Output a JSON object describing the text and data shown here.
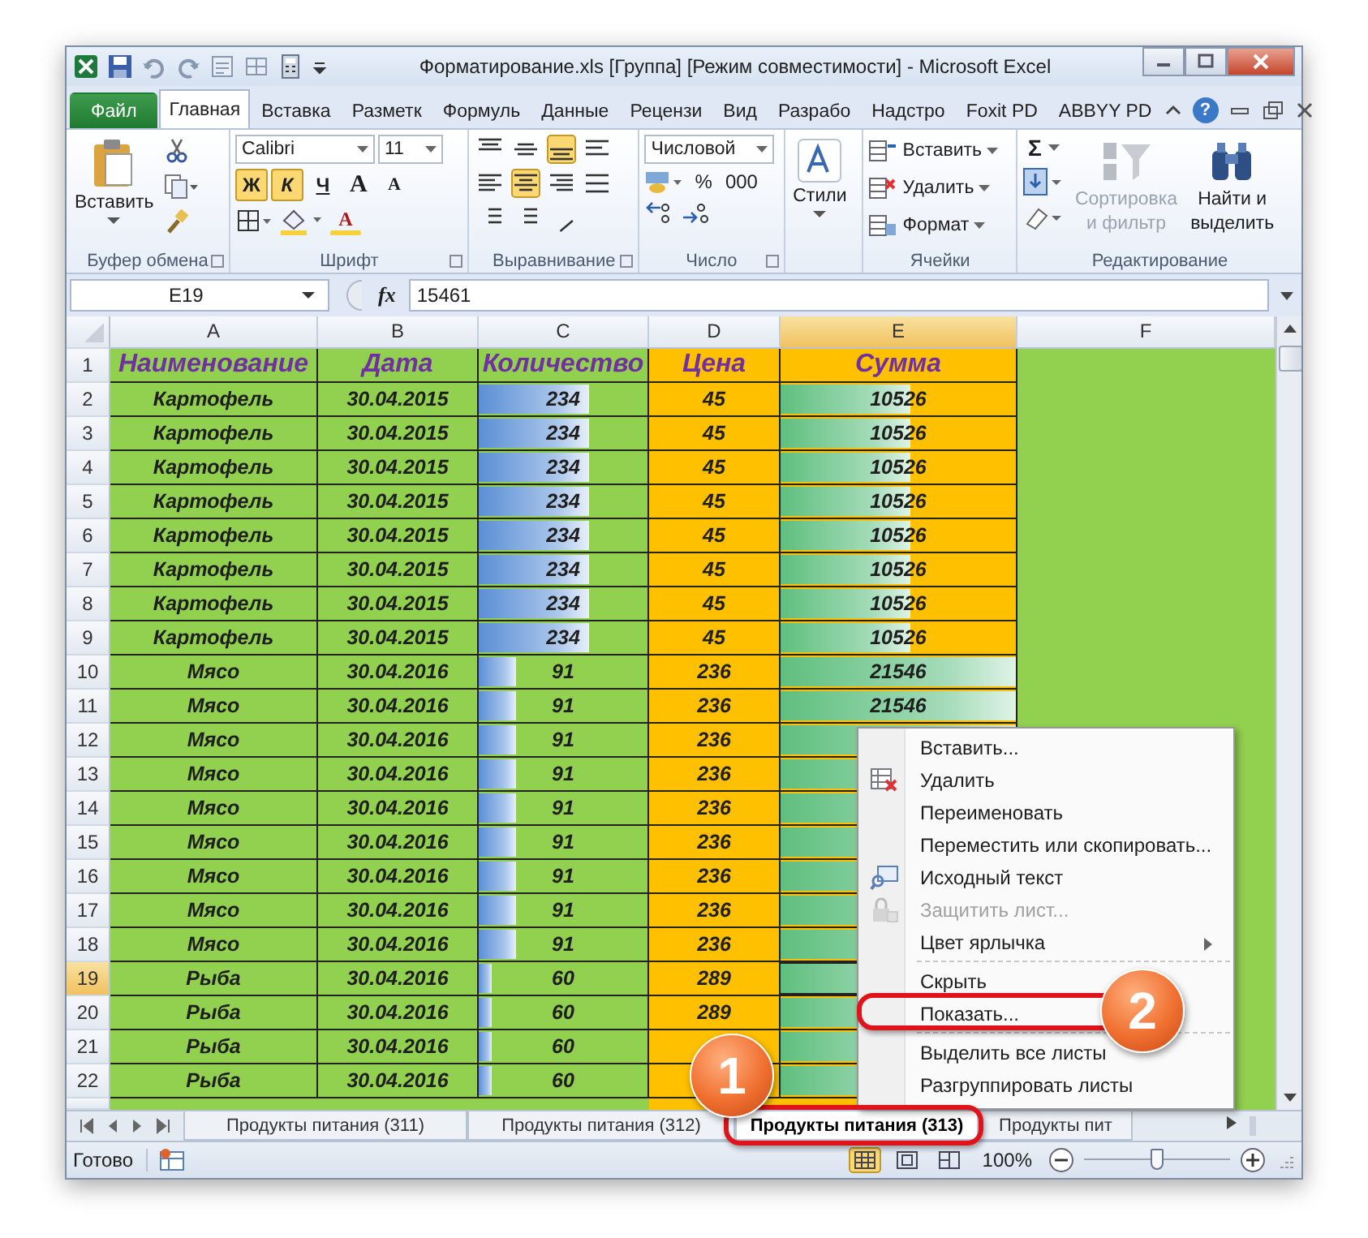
{
  "window": {
    "title": "Форматирование.xls [Группа] [Режим совместимости] - Microsoft Excel"
  },
  "ribbon_tabs": [
    {
      "text": "Файл",
      "kind": "file",
      "selected": false
    },
    {
      "text": "Главная",
      "kind": "tab",
      "selected": true
    },
    {
      "text": "Вставка",
      "kind": "tab",
      "selected": false
    },
    {
      "text": "Разметк",
      "kind": "tab",
      "selected": false
    },
    {
      "text": "Формуль",
      "kind": "tab",
      "selected": false
    },
    {
      "text": "Данные",
      "kind": "tab",
      "selected": false
    },
    {
      "text": "Рецензи",
      "kind": "tab",
      "selected": false
    },
    {
      "text": "Вид",
      "kind": "tab",
      "selected": false
    },
    {
      "text": "Разрабо",
      "kind": "tab",
      "selected": false
    },
    {
      "text": "Надстро",
      "kind": "tab",
      "selected": false
    },
    {
      "text": "Foxit PD",
      "kind": "tab",
      "selected": false
    },
    {
      "text": "ABBYY PD",
      "kind": "tab",
      "selected": false
    }
  ],
  "help": "?",
  "clipboard": {
    "paste": "Вставить",
    "label": "Буфер обмена"
  },
  "font": {
    "family": "Calibri",
    "size": "11",
    "label": "Шрифт",
    "grow": "A",
    "shrink": "A",
    "color_letter": "A",
    "buttons": [
      {
        "text": "Ж",
        "selected": true
      },
      {
        "text": "К",
        "selected": true
      },
      {
        "text": "Ч",
        "selected": false
      }
    ]
  },
  "alignment": {
    "label": "Выравнивание",
    "rows": [
      [
        {
          "kind": "top",
          "selected": false
        },
        {
          "kind": "middle",
          "selected": false
        },
        {
          "kind": "bottom",
          "selected": true
        },
        {
          "kind": "wrap",
          "selected": false
        }
      ],
      [
        {
          "kind": "left",
          "selected": false
        },
        {
          "kind": "center",
          "selected": true
        },
        {
          "kind": "right",
          "selected": false
        },
        {
          "kind": "merge",
          "selected": false
        }
      ],
      [
        {
          "kind": "outdent",
          "selected": false
        },
        {
          "kind": "indent",
          "selected": false
        },
        {
          "kind": "orientation",
          "selected": false
        }
      ]
    ]
  },
  "number": {
    "format": "Числовой",
    "percent": "%",
    "thousands": "000",
    "label": "Число"
  },
  "styles": {
    "button": "Стили"
  },
  "cells_group": {
    "label": "Ячейки",
    "items": [
      {
        "kind": "insert",
        "text": "Вставить"
      },
      {
        "kind": "delete",
        "text": "Удалить"
      },
      {
        "kind": "format",
        "text": "Формат"
      }
    ]
  },
  "editing": {
    "label": "Редактирование",
    "sigma": "Σ",
    "sort": {
      "lines": [
        "Сортировка",
        "и фильтр"
      ],
      "disabled": true
    },
    "find": {
      "lines": [
        "Найти и",
        "выделить"
      ]
    }
  },
  "formula_bar": {
    "name_box": "E19",
    "fx": "fx",
    "value": "15461"
  },
  "columns": [
    {
      "label": "A",
      "selected": false,
      "color": "#92d050"
    },
    {
      "label": "B",
      "selected": false,
      "color": "#92d050"
    },
    {
      "label": "C",
      "selected": false,
      "color": "#92d050"
    },
    {
      "label": "D",
      "selected": false,
      "color": "#ffc000"
    },
    {
      "label": "E",
      "selected": true,
      "color": "#ffc000"
    },
    {
      "label": "F",
      "selected": false,
      "color": "#92d050"
    }
  ],
  "rows": [
    {
      "number": "1",
      "selected": false,
      "kind": "header",
      "cells": [
        {
          "text": "Наименование"
        },
        {
          "text": "Дата"
        },
        {
          "text": "Количество"
        },
        {
          "text": "Цена"
        },
        {
          "text": "Сумма"
        }
      ]
    },
    {
      "number": "2",
      "selected": false,
      "kind": "data",
      "cells": [
        {
          "text": "Картофель"
        },
        {
          "text": "30.04.2015"
        },
        {
          "text": "234",
          "level": 0.65
        },
        {
          "text": "45"
        },
        {
          "text": "10526",
          "level": 0.55
        }
      ]
    },
    {
      "number": "3",
      "selected": false,
      "kind": "data",
      "cells": [
        {
          "text": "Картофель"
        },
        {
          "text": "30.04.2015"
        },
        {
          "text": "234",
          "level": 0.65
        },
        {
          "text": "45"
        },
        {
          "text": "10526",
          "level": 0.55
        }
      ]
    },
    {
      "number": "4",
      "selected": false,
      "kind": "data",
      "cells": [
        {
          "text": "Картофель"
        },
        {
          "text": "30.04.2015"
        },
        {
          "text": "234",
          "level": 0.65
        },
        {
          "text": "45"
        },
        {
          "text": "10526",
          "level": 0.55
        }
      ]
    },
    {
      "number": "5",
      "selected": false,
      "kind": "data",
      "cells": [
        {
          "text": "Картофель"
        },
        {
          "text": "30.04.2015"
        },
        {
          "text": "234",
          "level": 0.65
        },
        {
          "text": "45"
        },
        {
          "text": "10526",
          "level": 0.55
        }
      ]
    },
    {
      "number": "6",
      "selected": false,
      "kind": "data",
      "cells": [
        {
          "text": "Картофель"
        },
        {
          "text": "30.04.2015"
        },
        {
          "text": "234",
          "level": 0.65
        },
        {
          "text": "45"
        },
        {
          "text": "10526",
          "level": 0.55
        }
      ]
    },
    {
      "number": "7",
      "selected": false,
      "kind": "data",
      "cells": [
        {
          "text": "Картофель"
        },
        {
          "text": "30.04.2015"
        },
        {
          "text": "234",
          "level": 0.65
        },
        {
          "text": "45"
        },
        {
          "text": "10526",
          "level": 0.55
        }
      ]
    },
    {
      "number": "8",
      "selected": false,
      "kind": "data",
      "cells": [
        {
          "text": "Картофель"
        },
        {
          "text": "30.04.2015"
        },
        {
          "text": "234",
          "level": 0.65
        },
        {
          "text": "45"
        },
        {
          "text": "10526",
          "level": 0.55
        }
      ]
    },
    {
      "number": "9",
      "selected": false,
      "kind": "data",
      "cells": [
        {
          "text": "Картофель"
        },
        {
          "text": "30.04.2015"
        },
        {
          "text": "234",
          "level": 0.65
        },
        {
          "text": "45"
        },
        {
          "text": "10526",
          "level": 0.55
        }
      ]
    },
    {
      "number": "10",
      "selected": false,
      "kind": "data",
      "cells": [
        {
          "text": "Мясо"
        },
        {
          "text": "30.04.2016"
        },
        {
          "text": "91",
          "level": 0.22
        },
        {
          "text": "236"
        },
        {
          "text": "21546",
          "level": 1
        }
      ]
    },
    {
      "number": "11",
      "selected": false,
      "kind": "data",
      "cells": [
        {
          "text": "Мясо"
        },
        {
          "text": "30.04.2016"
        },
        {
          "text": "91",
          "level": 0.22
        },
        {
          "text": "236"
        },
        {
          "text": "21546",
          "level": 1
        }
      ]
    },
    {
      "number": "12",
      "selected": false,
      "kind": "data",
      "cells": [
        {
          "text": "Мясо"
        },
        {
          "text": "30.04.2016"
        },
        {
          "text": "91",
          "level": 0.22
        },
        {
          "text": "236"
        },
        {
          "level": 1
        }
      ]
    },
    {
      "number": "13",
      "selected": false,
      "kind": "data",
      "cells": [
        {
          "text": "Мясо"
        },
        {
          "text": "30.04.2016"
        },
        {
          "text": "91",
          "level": 0.22
        },
        {
          "text": "236"
        },
        {
          "level": 1
        }
      ]
    },
    {
      "number": "14",
      "selected": false,
      "kind": "data",
      "cells": [
        {
          "text": "Мясо"
        },
        {
          "text": "30.04.2016"
        },
        {
          "text": "91",
          "level": 0.22
        },
        {
          "text": "236"
        },
        {
          "level": 1
        }
      ]
    },
    {
      "number": "15",
      "selected": false,
      "kind": "data",
      "cells": [
        {
          "text": "Мясо"
        },
        {
          "text": "30.04.2016"
        },
        {
          "text": "91",
          "level": 0.22
        },
        {
          "text": "236"
        },
        {
          "level": 1
        }
      ]
    },
    {
      "number": "16",
      "selected": false,
      "kind": "data",
      "cells": [
        {
          "text": "Мясо"
        },
        {
          "text": "30.04.2016"
        },
        {
          "text": "91",
          "level": 0.22
        },
        {
          "text": "236"
        },
        {
          "level": 1
        }
      ]
    },
    {
      "number": "17",
      "selected": false,
      "kind": "data",
      "cells": [
        {
          "text": "Мясо"
        },
        {
          "text": "30.04.2016"
        },
        {
          "text": "91",
          "level": 0.22
        },
        {
          "text": "236"
        },
        {
          "level": 1
        }
      ]
    },
    {
      "number": "18",
      "selected": false,
      "kind": "data",
      "cells": [
        {
          "text": "Мясо"
        },
        {
          "text": "30.04.2016"
        },
        {
          "text": "91",
          "level": 0.22
        },
        {
          "text": "236"
        },
        {
          "level": 1
        }
      ]
    },
    {
      "number": "19",
      "selected": true,
      "kind": "data",
      "cells": [
        {
          "text": "Рыба"
        },
        {
          "text": "30.04.2016"
        },
        {
          "text": "60",
          "level": 0.08
        },
        {
          "text": "289"
        },
        {
          "level": 0.7
        }
      ]
    },
    {
      "number": "20",
      "selected": false,
      "kind": "data",
      "cells": [
        {
          "text": "Рыба"
        },
        {
          "text": "30.04.2016"
        },
        {
          "text": "60",
          "level": 0.08
        },
        {
          "text": "289"
        },
        {
          "level": 0.7
        }
      ]
    },
    {
      "number": "21",
      "selected": false,
      "kind": "data",
      "cells": [
        {
          "text": "Рыба"
        },
        {
          "text": "30.04.2016"
        },
        {
          "text": "60",
          "level": 0.08
        },
        {},
        {
          "level": 0.7
        }
      ]
    },
    {
      "number": "22",
      "selected": false,
      "kind": "data",
      "cells": [
        {
          "text": "Рыба"
        },
        {
          "text": "30.04.2016"
        },
        {
          "text": "60",
          "level": 0.08
        },
        {},
        {
          "level": 0.7
        }
      ]
    }
  ],
  "sheet_tabs": [
    {
      "text": "Продукты питания (311)",
      "selected": false
    },
    {
      "text": "Продукты питания (312)",
      "selected": false
    },
    {
      "text": "Продукты питания (313)",
      "selected": true
    },
    {
      "text": "Продукты пит",
      "selected": false
    }
  ],
  "context_menu": {
    "items": [
      {
        "kind": "plain",
        "text": "Вставить...",
        "disabled": false
      },
      {
        "kind": "delete",
        "text": "Удалить",
        "disabled": false
      },
      {
        "kind": "plain",
        "text": "Переименовать",
        "disabled": false
      },
      {
        "kind": "plain",
        "text": "Переместить или скопировать...",
        "disabled": false
      },
      {
        "kind": "code",
        "text": "Исходный текст",
        "disabled": false
      },
      {
        "kind": "protect",
        "text": "Защитить лист...",
        "disabled": true
      },
      {
        "kind": "submenu",
        "text": "Цвет ярлычка",
        "disabled": false
      },
      {
        "kind": "separator"
      },
      {
        "kind": "plain",
        "text": "Скрыть",
        "disabled": false
      },
      {
        "kind": "plain",
        "text": "Показать...",
        "disabled": false
      },
      {
        "kind": "separator"
      },
      {
        "kind": "plain",
        "text": "Выделить все листы",
        "disabled": false
      },
      {
        "kind": "plain",
        "text": "Разгруппировать листы",
        "disabled": false
      }
    ]
  },
  "callouts": [
    {
      "text": "1"
    },
    {
      "text": "2"
    }
  ],
  "status_bar": {
    "text": "Готово",
    "views": [
      {
        "kind": "normal",
        "selected": true
      },
      {
        "kind": "layout",
        "selected": false
      },
      {
        "kind": "pagebreak",
        "selected": false
      }
    ],
    "zoom": "100%",
    "zoom_slider": {
      "level": 0.5
    }
  }
}
